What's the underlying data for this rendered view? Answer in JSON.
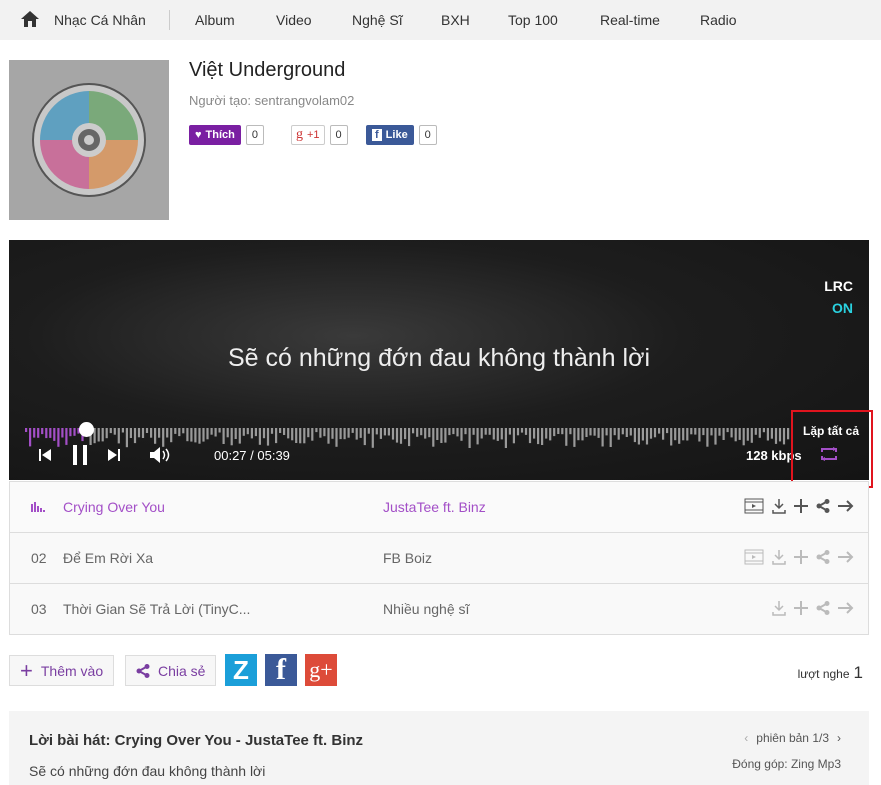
{
  "nav": {
    "items": [
      "Nhạc Cá Nhân",
      "Album",
      "Video",
      "Nghệ Sĩ",
      "BXH",
      "Top 100",
      "Real-time",
      "Radio"
    ]
  },
  "playlist": {
    "title": "Việt Underground",
    "creator": "Người tạo: sentrangvolam02"
  },
  "social": {
    "like_label": "Thích",
    "like_count": "0",
    "gplus_label": "+1",
    "gplus_count": "0",
    "fb_label": "Like",
    "fb_count": "0"
  },
  "player": {
    "lrc_label": "LRC",
    "lrc_state": "ON",
    "lyric": "Sẽ có những đớn đau không thành lời",
    "time": "00:27 / 05:39",
    "progress": 0.08,
    "bitrate": "128 kbps",
    "repeat_label": "Lặp tất cả",
    "accent": "#a34fc7"
  },
  "tracks": [
    {
      "num": "",
      "name": "Crying Over You",
      "artist": "JustaTee  ft. Binz",
      "active": true,
      "mv": true
    },
    {
      "num": "02",
      "name": "Để Em Rời Xa",
      "artist": "FB Boiz",
      "active": false,
      "mv": true
    },
    {
      "num": "03",
      "name": "Thời Gian Sẽ Trả Lời (TinyC...",
      "artist": "Nhiều nghệ sĩ",
      "active": false,
      "mv": false
    }
  ],
  "actions": {
    "add": "Thêm vào",
    "share": "Chia sẻ",
    "zing": "Z",
    "fb": "f",
    "gplus": "g+",
    "listens_label": "lượt nghe",
    "listens": "1"
  },
  "lyrics": {
    "title": "Lời bài hát: Crying Over You - JustaTee ft. Binz",
    "first_line": "Sẽ có những đớn đau không thành lời",
    "version": "phiên bản 1/3",
    "contributor": "Đóng góp: Zing Mp3"
  }
}
